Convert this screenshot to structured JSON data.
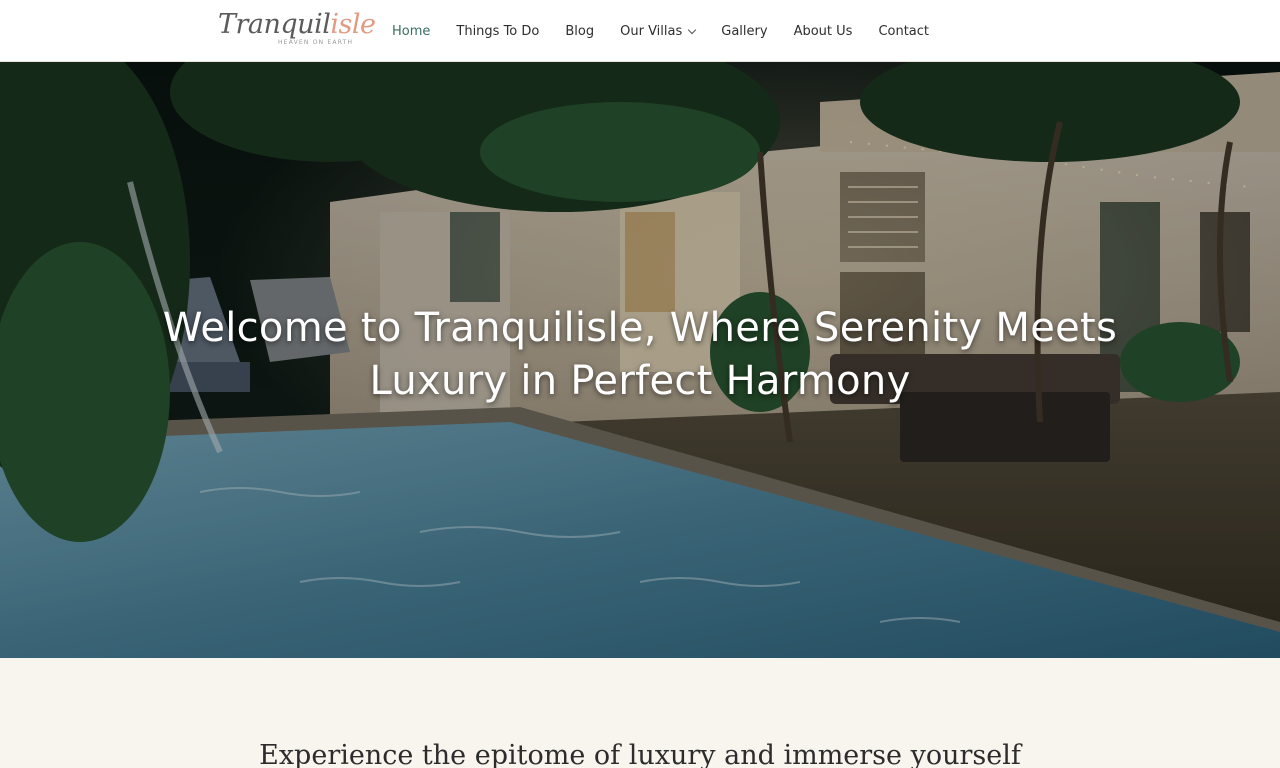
{
  "brand": {
    "name_part1": "Tranquil",
    "name_part2": "isle",
    "tagline": "HEAVEN ON EARTH",
    "colors": {
      "primary": "#5b5b5b",
      "accent": "#e39a82",
      "nav_active": "#3a6f63"
    }
  },
  "nav": {
    "items": [
      {
        "label": "Home",
        "active": true
      },
      {
        "label": "Things To Do",
        "active": false
      },
      {
        "label": "Blog",
        "active": false
      },
      {
        "label": "Our Villas",
        "active": false,
        "has_dropdown": true,
        "icon": "chevron-down-icon"
      },
      {
        "label": "Gallery",
        "active": false
      },
      {
        "label": "About Us",
        "active": false
      },
      {
        "label": "Contact",
        "active": false
      }
    ]
  },
  "hero": {
    "title": "Welcome to Tranquilisle, Where Serenity Meets Luxury in Perfect Harmony"
  },
  "intro": {
    "text": "Experience the epitome of luxury and immerse yourself"
  },
  "section_background": "#f8f5ef"
}
